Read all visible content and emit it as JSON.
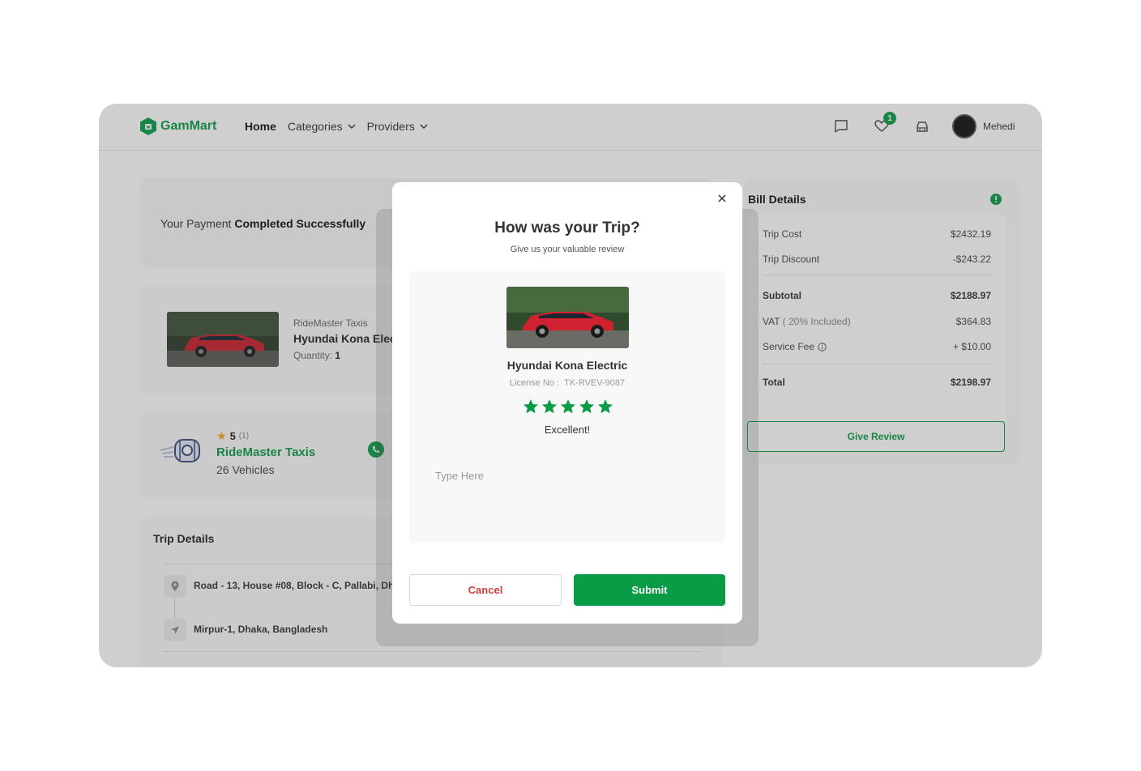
{
  "colors": {
    "brand": "#0a9b47",
    "danger": "#d23f3f",
    "star": "#0a9b47"
  },
  "header": {
    "logo_text": "GamMart",
    "nav": {
      "home": "Home",
      "categories": "Categories",
      "providers": "Providers"
    },
    "wishlist_count": "1",
    "user_name": "Mehedi",
    "icons": [
      "chat-icon",
      "heart-icon",
      "car-icon"
    ]
  },
  "payment": {
    "prefix": "Your Payment ",
    "status": "Completed Successfully"
  },
  "product": {
    "provider": "RideMaster Taxis",
    "name": "Hyundai Kona Electric",
    "quantity_label": "Quantity: ",
    "quantity": "1"
  },
  "provider_card": {
    "rating": "5",
    "rating_count": "(1)",
    "name": "RideMaster Taxis",
    "vehicles": "26 Vehicles"
  },
  "trip": {
    "title": "Trip Details",
    "pickup": "Road - 13, House #08, Block - C, Pallabi, Dhaka, Bangladesh",
    "dropoff": "Mirpur-1, Dhaka, Bangladesh"
  },
  "bill": {
    "title": "Bill Details",
    "trip_cost_label": "Trip Cost",
    "trip_cost": "$2432.19",
    "trip_discount_label": "Trip Discount",
    "trip_discount": "-$243.22",
    "subtotal_label": "Subtotal",
    "subtotal": "$2188.97",
    "vat_label": "VAT",
    "vat_note": " ( 20% Included)",
    "vat": "$364.83",
    "service_fee_label": "Service Fee",
    "service_fee": "+ $10.00",
    "total_label": "Total",
    "total": "$2198.97",
    "give_review": "Give Review"
  },
  "modal": {
    "title": "How was your Trip?",
    "subtitle": "Give us your valuable review",
    "vehicle_name": "Hyundai Kona Electric",
    "license_label": "License No :",
    "license": "TK-RVEV-9087",
    "rating": 5,
    "rating_label": "Excellent!",
    "review_placeholder": "Type Here",
    "cancel": "Cancel",
    "submit": "Submit"
  }
}
